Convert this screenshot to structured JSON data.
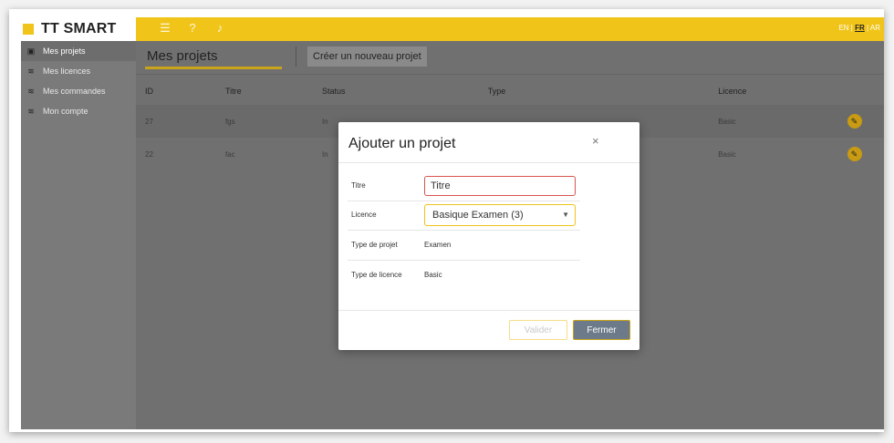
{
  "brand": {
    "name": "TT SMART"
  },
  "topbar": {
    "icons": [
      "menu-icon",
      "help-icon",
      "bell-icon"
    ],
    "lang": {
      "en": "EN",
      "sep1": "|",
      "fr": "FR",
      "sep2": "|",
      "ar": "AR"
    }
  },
  "sidebar": {
    "items": [
      {
        "label": "Mes projets",
        "icon": "folder-icon"
      },
      {
        "label": "Mes licences",
        "icon": "stack-icon"
      },
      {
        "label": "Mes commandes",
        "icon": "stack-icon"
      },
      {
        "label": "Mon compte",
        "icon": "stack-icon"
      }
    ]
  },
  "main": {
    "tab_title": "Mes projets",
    "new_project_button": "Créer un nouveau projet",
    "table": {
      "headers": {
        "id": "ID",
        "title": "Titre",
        "status": "Status",
        "type": "Type",
        "licence": "Licence"
      },
      "rows": [
        {
          "id": "27",
          "title": "fgs",
          "status": "In",
          "type": "",
          "licence": "Basic"
        },
        {
          "id": "22",
          "title": "fac",
          "status": "In",
          "type": "",
          "licence": "Basic"
        }
      ]
    }
  },
  "modal": {
    "title": "Ajouter un projet",
    "close": "×",
    "fields": {
      "titre_label": "Titre",
      "titre_value": "Titre",
      "licence_label": "Licence",
      "licence_value": "Basique Examen (3)",
      "type_projet_label": "Type de projet",
      "type_projet_value": "Examen",
      "type_licence_label": "Type de licence",
      "type_licence_value": "Basic"
    },
    "buttons": {
      "valider": "Valider",
      "fermer": "Fermer"
    }
  },
  "colors": {
    "accent": "#f0c419",
    "overlay": "#707070",
    "fermer": "#6c7a89"
  }
}
